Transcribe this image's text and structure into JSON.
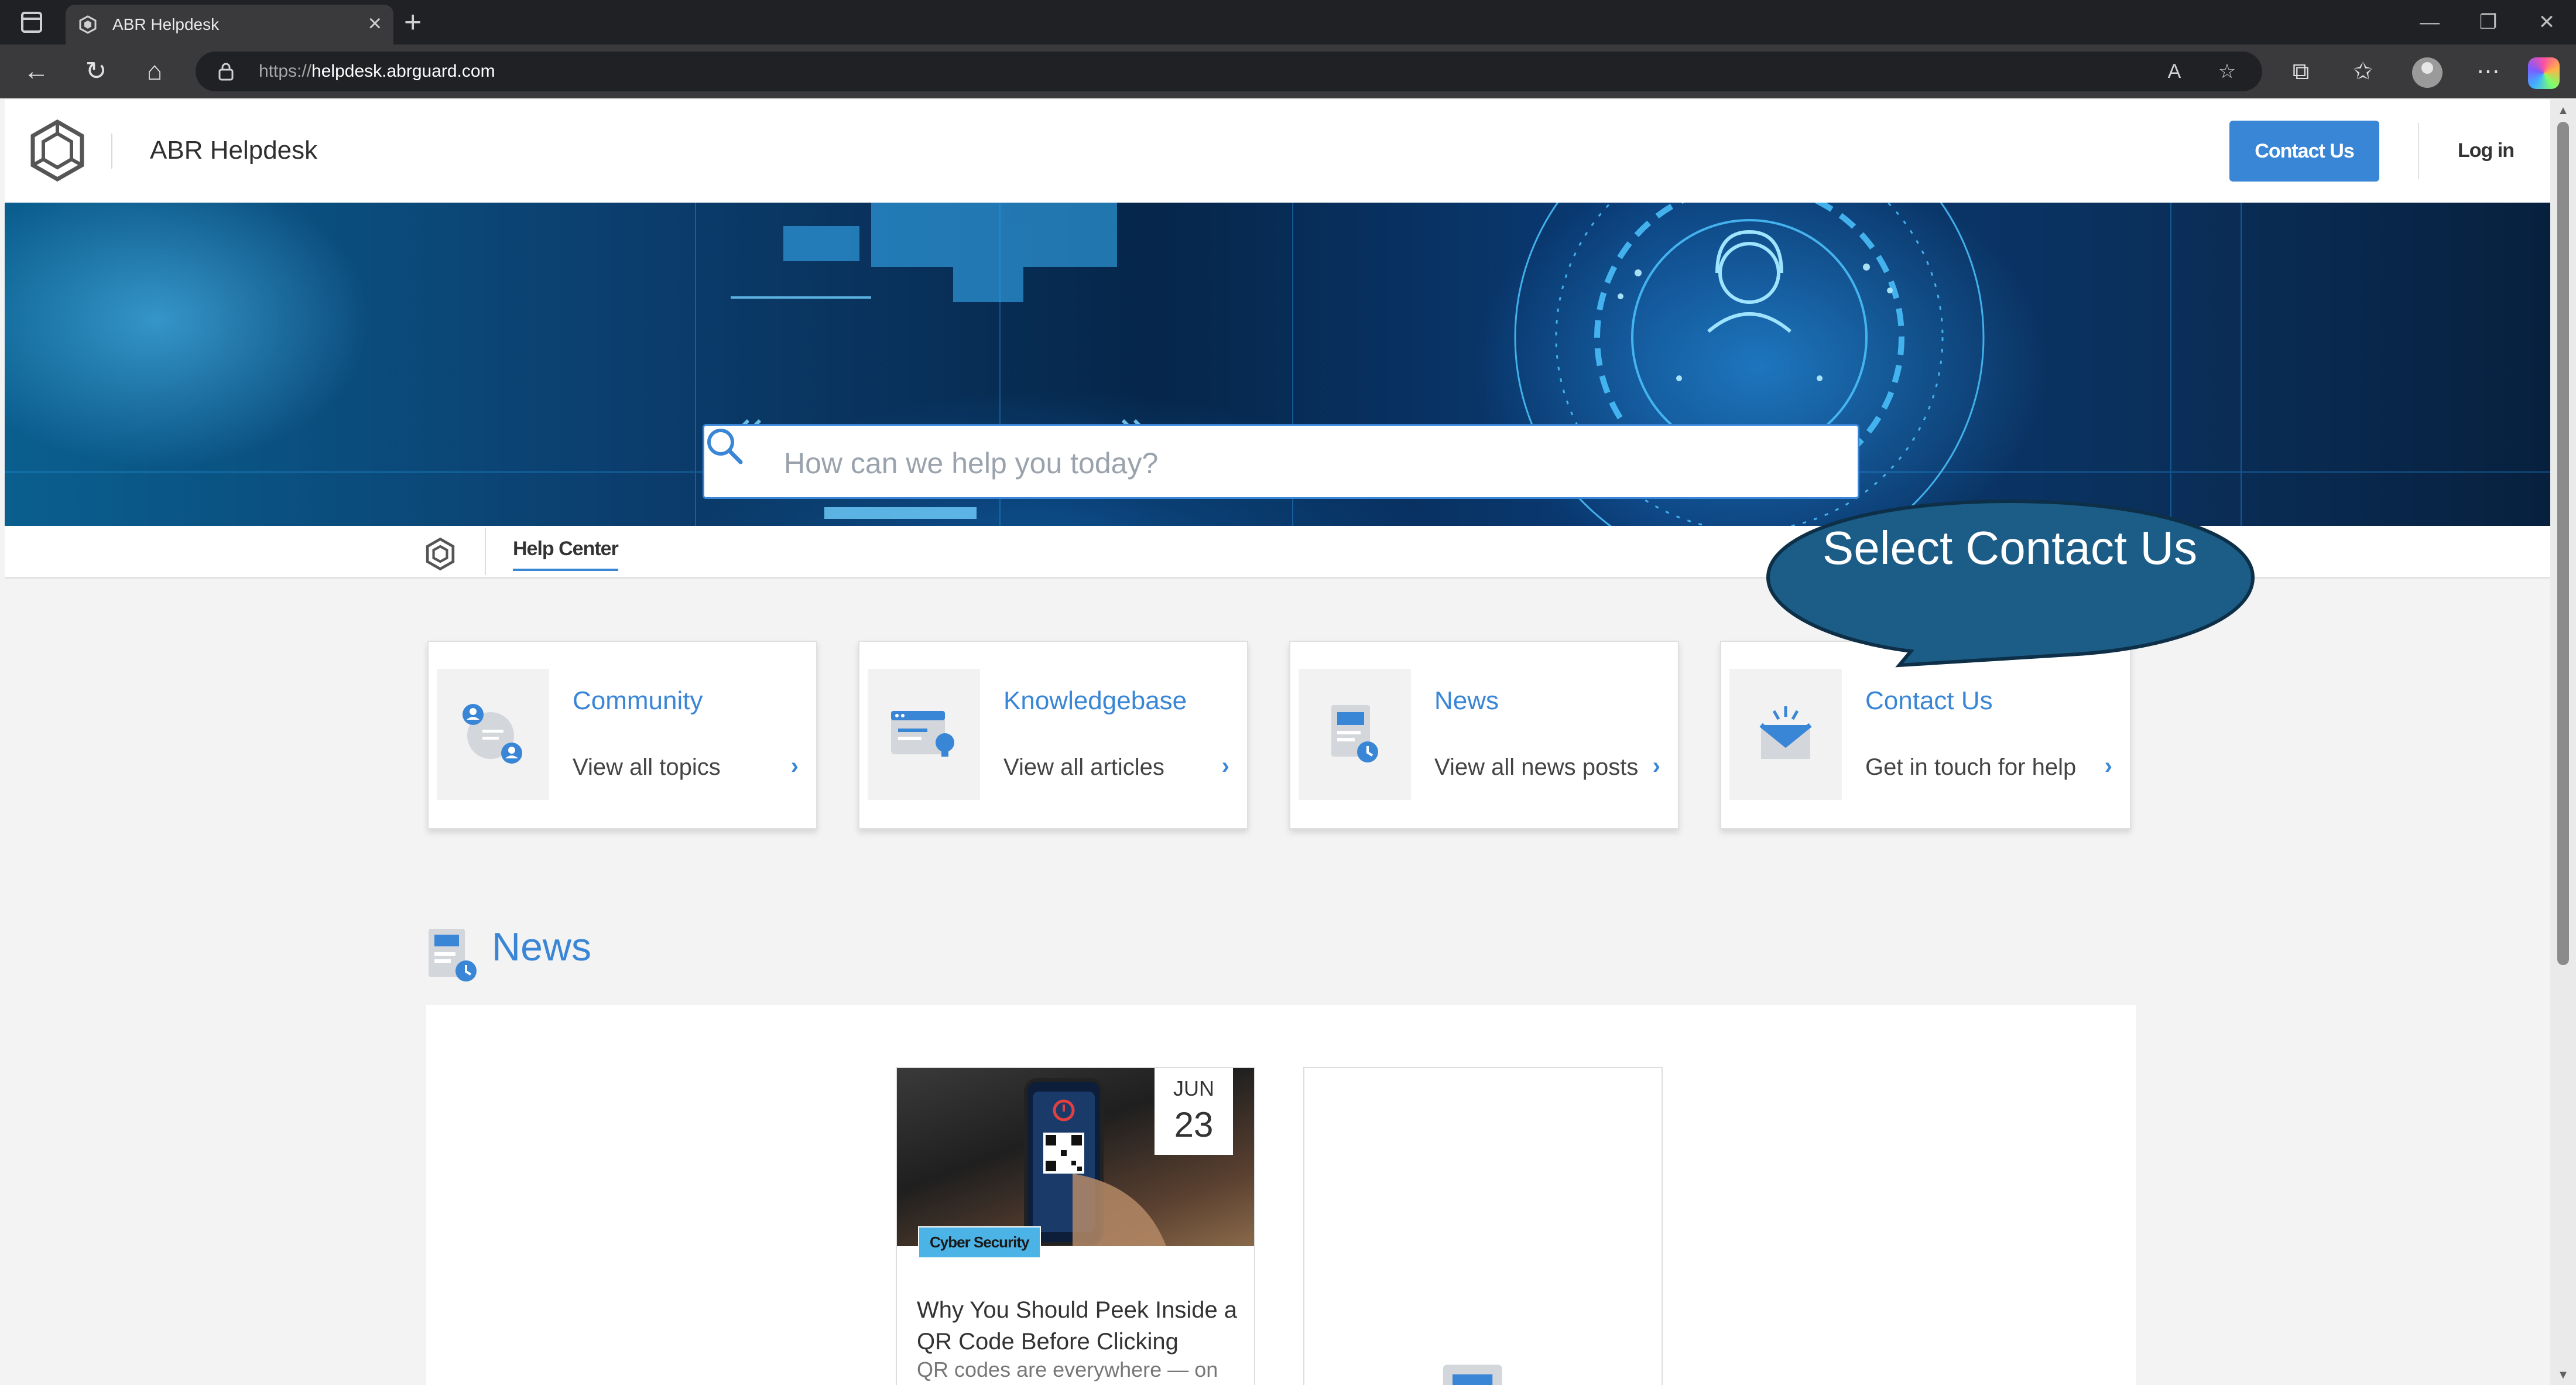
{
  "browser": {
    "tab_title": "ABR Helpdesk",
    "tab_close": "×",
    "new_tab": "+",
    "url_scheme": "https://",
    "url_host": "helpdesk.abrguard.com",
    "controls": {
      "minimize": "—",
      "restore": "❐",
      "close": "✕"
    }
  },
  "header": {
    "site_name": "ABR Helpdesk",
    "contact_button": "Contact Us",
    "login": "Log in"
  },
  "search": {
    "placeholder": "How can we help you today?"
  },
  "subnav": {
    "tab": "Help Center"
  },
  "callout": {
    "text": "Select Contact Us"
  },
  "cards": [
    {
      "title": "Community",
      "subtitle": "View all topics",
      "icon": "community-icon"
    },
    {
      "title": "Knowledgebase",
      "subtitle": "View all articles",
      "icon": "knowledgebase-icon"
    },
    {
      "title": "News",
      "subtitle": "View all news posts",
      "icon": "news-icon"
    },
    {
      "title": "Contact Us",
      "subtitle": "Get in touch for help",
      "icon": "envelope-icon"
    }
  ],
  "news": {
    "heading": "News",
    "posts": [
      {
        "month": "JUN",
        "day": "23",
        "tag": "Cyber Security",
        "title": "Why You Should Peek Inside a QR Code Before Clicking",
        "excerpt": "QR codes are everywhere — on"
      }
    ]
  },
  "colors": {
    "accent": "#3a86d6",
    "callout": "#1b5d86",
    "tag": "#4bb3e6"
  }
}
